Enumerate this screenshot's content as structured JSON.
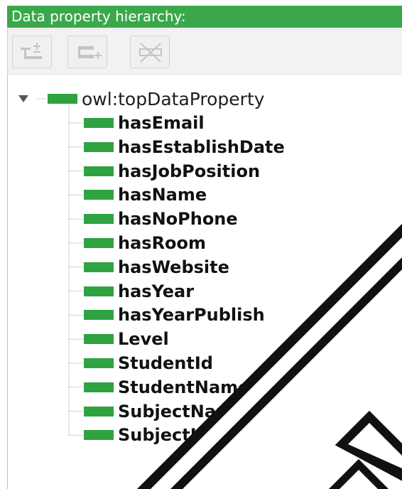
{
  "panel": {
    "title": "Data property hierarchy:"
  },
  "toolbar": {
    "buttons": [
      {
        "icon": "add-sub-property-icon"
      },
      {
        "icon": "add-sibling-property-icon"
      },
      {
        "icon": "delete-property-icon"
      }
    ]
  },
  "tree": {
    "root": {
      "label": "owl:topDataProperty",
      "expanded": true
    },
    "children": [
      {
        "label": "hasEmail"
      },
      {
        "label": "hasEstablishDate"
      },
      {
        "label": "hasJobPosition"
      },
      {
        "label": "hasName"
      },
      {
        "label": "hasNoPhone"
      },
      {
        "label": "hasRoom"
      },
      {
        "label": "hasWebsite"
      },
      {
        "label": "hasYear"
      },
      {
        "label": "hasYearPublish"
      },
      {
        "label": "Level"
      },
      {
        "label": "StudentId"
      },
      {
        "label": "StudentName"
      },
      {
        "label": "SubjectName"
      },
      {
        "label": "SubjectUnit"
      }
    ]
  },
  "colors": {
    "header_green": "#3aa84a",
    "property_green": "#2ea33f"
  }
}
